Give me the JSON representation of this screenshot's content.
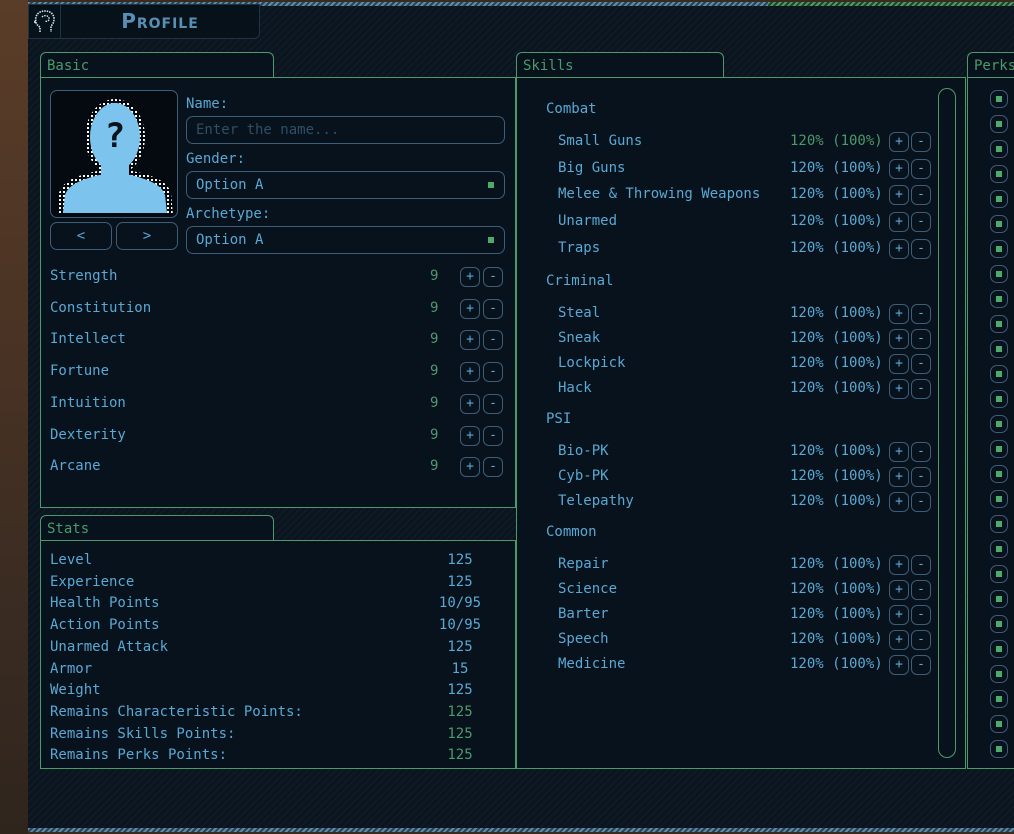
{
  "window": {
    "title": "Profile",
    "title_icon": "head-profile-icon"
  },
  "basic": {
    "tab_label": "Basic",
    "avatar_icon": "unknown-person-icon",
    "prev_label": "<",
    "next_label": ">",
    "name_label": "Name:",
    "name_value": "",
    "name_placeholder": "Enter the name...",
    "gender_label": "Gender:",
    "gender_value": "Option A",
    "archetype_label": "Archetype:",
    "archetype_value": "Option A",
    "attributes": [
      {
        "name": "Strength",
        "value": "9"
      },
      {
        "name": "Constitution",
        "value": "9"
      },
      {
        "name": "Intellect",
        "value": "9"
      },
      {
        "name": "Fortune",
        "value": "9"
      },
      {
        "name": "Intuition",
        "value": "9"
      },
      {
        "name": "Dexterity",
        "value": "9"
      },
      {
        "name": "Arcane",
        "value": "9"
      }
    ],
    "plus_label": "+",
    "minus_label": "-"
  },
  "stats": {
    "tab_label": "Stats",
    "rows": [
      {
        "name": "Level",
        "value": "125"
      },
      {
        "name": "Experience",
        "value": "125"
      },
      {
        "name": "Health Points",
        "value": "10/95"
      },
      {
        "name": "Action Points",
        "value": "10/95"
      },
      {
        "name": "Unarmed Attack",
        "value": "125"
      },
      {
        "name": "Armor",
        "value": "15"
      },
      {
        "name": "Weight",
        "value": "125"
      },
      {
        "name": "Remains Characteristic Points:",
        "value": "125"
      },
      {
        "name": "Remains Skills Points:",
        "value": "125"
      },
      {
        "name": "Remains Perks Points:",
        "value": "125"
      }
    ]
  },
  "skills": {
    "tab_label": "Skills",
    "categories": [
      {
        "name": "Combat",
        "items": [
          {
            "name": "Small Guns",
            "value": "120% (100%)",
            "highlight": true
          },
          {
            "name": "Big Guns",
            "value": "120% (100%)"
          },
          {
            "name": "Melee & Throwing Weapons",
            "value": "120% (100%)"
          },
          {
            "name": "Unarmed",
            "value": "120% (100%)"
          },
          {
            "name": "Traps",
            "value": "120% (100%)"
          }
        ]
      },
      {
        "name": "Criminal",
        "items": [
          {
            "name": "Steal",
            "value": "120% (100%)"
          },
          {
            "name": "Sneak",
            "value": "120% (100%)"
          },
          {
            "name": "Lockpick",
            "value": "120% (100%)"
          },
          {
            "name": "Hack",
            "value": "120% (100%)"
          }
        ]
      },
      {
        "name": "PSI",
        "items": [
          {
            "name": "Bio-PK",
            "value": "120% (100%)"
          },
          {
            "name": "Cyb-PK",
            "value": "120% (100%)"
          },
          {
            "name": "Telepathy",
            "value": "120% (100%)"
          }
        ]
      },
      {
        "name": "Common",
        "items": [
          {
            "name": "Repair",
            "value": "120% (100%)"
          },
          {
            "name": "Science",
            "value": "120% (100%)"
          },
          {
            "name": "Barter",
            "value": "120% (100%)"
          },
          {
            "name": "Speech",
            "value": "120% (100%)"
          },
          {
            "name": "Medicine",
            "value": "120% (100%)"
          }
        ]
      }
    ]
  },
  "perks": {
    "tab_label": "Perks",
    "checkbox_count": 27
  },
  "colors": {
    "accent_green": "#4c9a6a",
    "text_blue": "#5aa8d4",
    "background": "#0a1520"
  }
}
